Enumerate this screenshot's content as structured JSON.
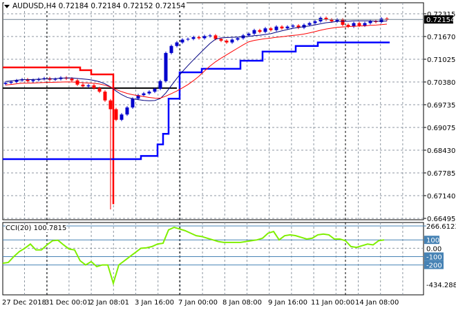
{
  "header": {
    "symbol": "AUDUSD,H4",
    "ohlc": "0.72184 0.72184 0.72152 0.72154"
  },
  "current_price": "0.72154",
  "colors": {
    "bull": "#0000cc",
    "bear": "#ff0000",
    "ma_fast": "#000080",
    "ma_slow": "#ff0000",
    "upper_channel": "#ff0000",
    "lower_channel": "#0000ff",
    "support": "#000000",
    "cci": "#7fef00",
    "cci_level": "#4682b4",
    "grid": "#8c96a0",
    "price_tag": "#000000"
  },
  "chart_data": [
    {
      "type": "candlestick",
      "title": "AUDUSD,H4",
      "ylim": [
        0.66495,
        0.72315
      ],
      "y_ticks": [
        "0.72315",
        "0.71670",
        "0.71025",
        "0.70380",
        "0.69735",
        "0.69075",
        "0.68430",
        "0.67785",
        "0.67140",
        "0.66495"
      ],
      "x_ticks": [
        "27 Dec 2018",
        "31 Dec 00:01",
        "2 Jan 08:01",
        "3 Jan 16:00",
        "7 Jan 00:00",
        "8 Jan 08:00",
        "9 Jan 16:00",
        "11 Jan 00:00",
        "14 Jan 08:00"
      ],
      "grid": true,
      "closes": [
        0.7035,
        0.7038,
        0.7042,
        0.7045,
        0.704,
        0.7043,
        0.7046,
        0.7048,
        0.7044,
        0.7046,
        0.705,
        0.7047,
        0.7042,
        0.703,
        0.7025,
        0.7028,
        0.702,
        0.701,
        0.6985,
        0.696,
        0.693,
        0.6945,
        0.6965,
        0.699,
        0.7,
        0.7005,
        0.701,
        0.7018,
        0.704,
        0.712,
        0.714,
        0.715,
        0.7158,
        0.716,
        0.7165,
        0.7162,
        0.7168,
        0.717,
        0.716,
        0.7155,
        0.715,
        0.7158,
        0.7162,
        0.717,
        0.7175,
        0.7185,
        0.718,
        0.719,
        0.7185,
        0.7195,
        0.719,
        0.7195,
        0.7198,
        0.7192,
        0.72,
        0.7205,
        0.721,
        0.722,
        0.7215,
        0.721,
        0.7215,
        0.72,
        0.7195,
        0.7205,
        0.7198,
        0.7205,
        0.721,
        0.7208,
        0.7218,
        0.7215
      ],
      "spike_low": {
        "index": 19,
        "value": 0.6675
      },
      "upper_channel": [
        [
          0,
          13,
          0.7079
        ],
        [
          14,
          15,
          0.7071
        ],
        [
          16,
          19,
          0.7059
        ]
      ],
      "lower_channel": [
        [
          21,
          24,
          0.6818
        ],
        [
          25,
          27,
          0.6827
        ],
        [
          28,
          28,
          0.686
        ],
        [
          29,
          29,
          0.689
        ],
        [
          30,
          31,
          0.699
        ],
        [
          32,
          35,
          0.7065
        ],
        [
          36,
          42,
          0.7075
        ],
        [
          43,
          46,
          0.7098
        ],
        [
          47,
          52,
          0.7124
        ],
        [
          53,
          56,
          0.714
        ],
        [
          57,
          69,
          0.715
        ]
      ],
      "support_line": {
        "from": 0,
        "to": 30,
        "value": 0.702
      }
    },
    {
      "type": "line",
      "title": "CCI(20) 100.7815",
      "ylim": [
        -434.2883,
        266.6123
      ],
      "y_ticks": [
        "266.6123",
        "100",
        "0.00",
        "-100",
        "-200",
        "-434.2883"
      ],
      "levels": [
        266.6123,
        100,
        -100,
        -200
      ],
      "values": [
        -180,
        -170,
        -100,
        -40,
        0,
        50,
        -20,
        -20,
        40,
        90,
        95,
        40,
        -10,
        -20,
        -150,
        -200,
        -160,
        -220,
        -200,
        -200,
        -420,
        -200,
        -150,
        -100,
        -50,
        0,
        5,
        20,
        50,
        60,
        220,
        250,
        230,
        210,
        180,
        150,
        140,
        120,
        100,
        80,
        70,
        70,
        70,
        70,
        80,
        90,
        100,
        120,
        180,
        200,
        100,
        150,
        160,
        150,
        130,
        110,
        120,
        160,
        170,
        160,
        110,
        110,
        90,
        20,
        10,
        30,
        50,
        40,
        90,
        100
      ]
    }
  ]
}
